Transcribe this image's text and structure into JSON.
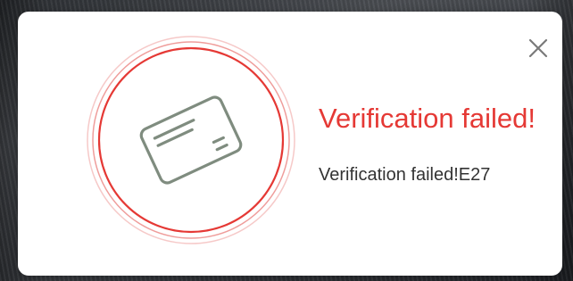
{
  "dialog": {
    "title": "Verification failed!",
    "message": "Verification failed!E27",
    "close_icon": "close-icon",
    "status_icon": "credit-card-icon"
  },
  "colors": {
    "error_accent": "#e53935",
    "icon_stroke": "#7f8c7f",
    "dialog_background": "#ffffff",
    "message_text": "#333333"
  }
}
